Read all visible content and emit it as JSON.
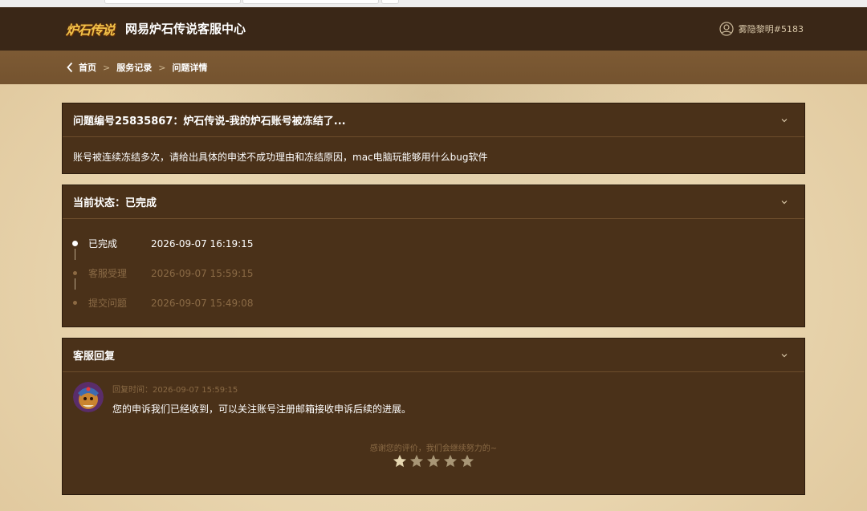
{
  "header": {
    "logo_text": "炉石传说",
    "site_title": "网易炉石传说客服中心",
    "username": "雾隐黎明#5183",
    "user_icon": "user-circle-icon"
  },
  "breadcrumb": {
    "back_icon": "chevron-left-icon",
    "items": [
      "首页",
      "服务记录",
      "问题详情"
    ],
    "separator": ">"
  },
  "question_panel": {
    "title": "问题编号25835867：炉石传说-我的炉石账号被冻结了...",
    "description": "账号被连续冻结多次，请给出具体的申述不成功理由和冻结原因，mac电脑玩能够用什么bug软件",
    "toggle_icon": "chevron-down-icon"
  },
  "status_panel": {
    "title": "当前状态：已完成",
    "toggle_icon": "chevron-down-icon",
    "timeline": [
      {
        "label": "已完成",
        "time": "2026-09-07 16:19:15",
        "active": true
      },
      {
        "label": "客服受理",
        "time": "2026-09-07 15:59:15",
        "active": false
      },
      {
        "label": "提交问题",
        "time": "2026-09-07 15:49:08",
        "active": false
      }
    ]
  },
  "reply_panel": {
    "title": "客服回复",
    "toggle_icon": "chevron-down-icon",
    "reply_time": "回复时间：2026-09-07 15:59:15",
    "reply_text": "您的申诉我们已经收到，可以关注账号注册邮箱接收申诉后续的进展。",
    "rating_message": "感谢您的评价，我们会继续努力的~",
    "rating": {
      "score": 1,
      "max": 5
    }
  },
  "colors": {
    "header_bg": "#3a2717",
    "crumb_bg": "#7a5732",
    "panel_bg": "#4a3119",
    "muted_text": "#8a6a45",
    "star_filled": "#e6d7b1",
    "star_empty": "#a89676"
  }
}
